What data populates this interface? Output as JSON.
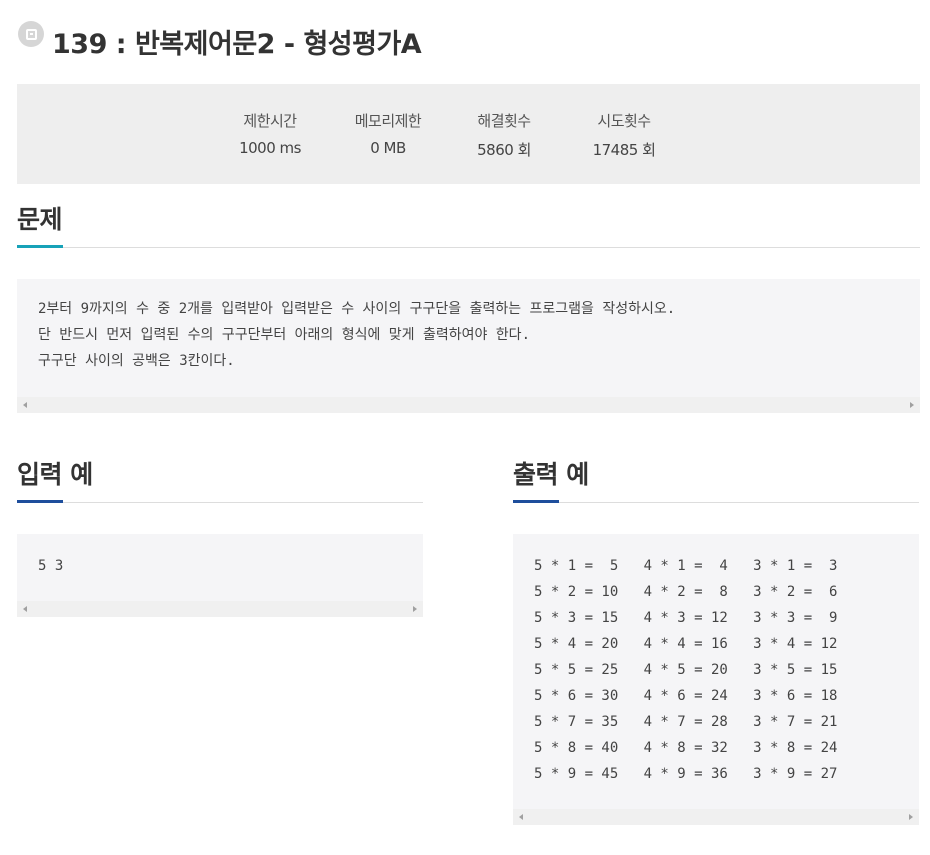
{
  "problem": {
    "number": "139",
    "title": "139 : 반복제어문2 - 형성평가A"
  },
  "stats": [
    {
      "label": "제한시간",
      "value": "1000 ms"
    },
    {
      "label": "메모리제한",
      "value": "0 MB"
    },
    {
      "label": "해결횟수",
      "value": "5860 회"
    },
    {
      "label": "시도횟수",
      "value": "17485 회"
    }
  ],
  "sections": {
    "problem_heading": "문제",
    "input_heading": "입력 예",
    "output_heading": "출력 예"
  },
  "description": "2부터 9까지의 수 중 2개를 입력받아 입력받은 수 사이의 구구단을 출력하는 프로그램을 작성하시오.\n단 반드시 먼저 입력된 수의 구구단부터 아래의 형식에 맞게 출력하여야 한다.\n구구단 사이의 공백은 3칸이다.",
  "input_example": "5 3",
  "output_example": "5 * 1 =  5   4 * 1 =  4   3 * 1 =  3\n5 * 2 = 10   4 * 2 =  8   3 * 2 =  6\n5 * 3 = 15   4 * 3 = 12   3 * 3 =  9\n5 * 4 = 20   4 * 4 = 16   3 * 4 = 12\n5 * 5 = 25   4 * 5 = 20   3 * 5 = 15\n5 * 6 = 30   4 * 6 = 24   3 * 6 = 18\n5 * 7 = 35   4 * 7 = 28   3 * 7 = 21\n5 * 8 = 40   4 * 8 = 32   3 * 8 = 24\n5 * 9 = 45   4 * 9 = 36   3 * 9 = 27",
  "colors": {
    "problem_accent": "#17a2b8",
    "example_accent": "#1e4e9c",
    "panel_bg": "#eeeeee",
    "code_bg": "#f5f5f7"
  },
  "icons": {
    "title_icon": "bookmark-icon",
    "scroll_left": "chevron-left-icon",
    "scroll_right": "chevron-right-icon"
  }
}
